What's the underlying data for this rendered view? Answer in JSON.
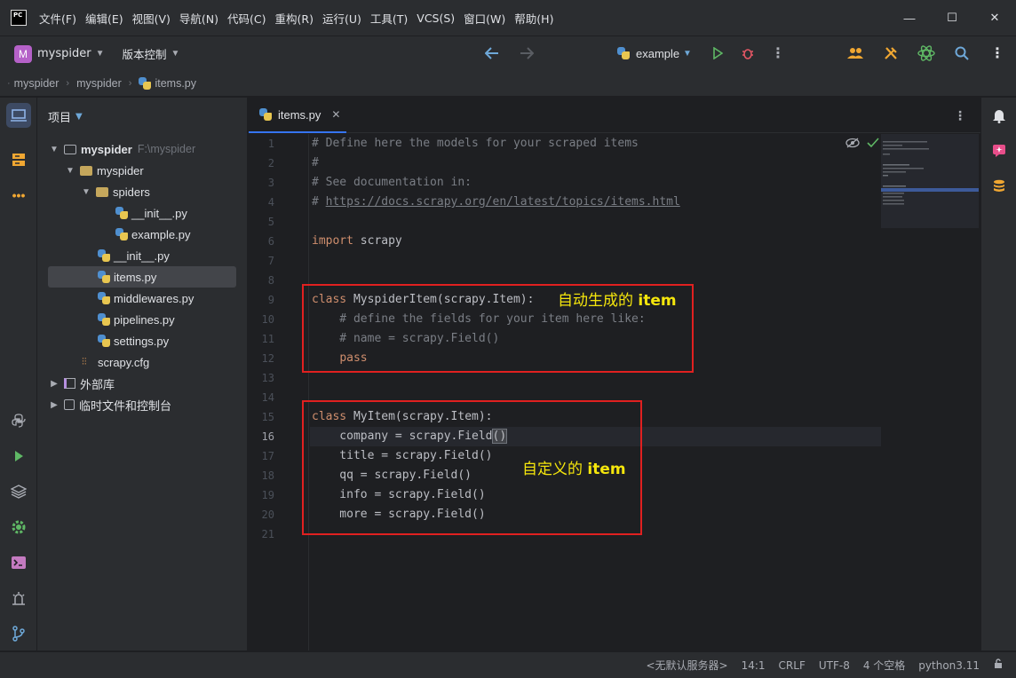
{
  "app": {
    "logo_text": "PC"
  },
  "menu": [
    "文件(F)",
    "编辑(E)",
    "视图(V)",
    "导航(N)",
    "代码(C)",
    "重构(R)",
    "运行(U)",
    "工具(T)",
    "VCS(S)",
    "窗口(W)",
    "帮助(H)"
  ],
  "window_controls": {
    "minimize": "—",
    "maximize": "☐",
    "close": "✕"
  },
  "toolbar": {
    "project_avatar": "M",
    "project_name": "myspider",
    "vcs_label": "版本控制",
    "run_config": "example"
  },
  "breadcrumb": [
    "myspider",
    "myspider",
    "items.py"
  ],
  "project_panel": {
    "title": "项目",
    "tree": [
      {
        "label": "myspider",
        "hint": "F:\\myspider",
        "type": "project"
      },
      {
        "label": "myspider",
        "type": "folder"
      },
      {
        "label": "spiders",
        "type": "folder"
      },
      {
        "label": "__init__.py",
        "type": "py"
      },
      {
        "label": "example.py",
        "type": "py"
      },
      {
        "label": "__init__.py",
        "type": "py"
      },
      {
        "label": "items.py",
        "type": "py",
        "selected": true
      },
      {
        "label": "middlewares.py",
        "type": "py"
      },
      {
        "label": "pipelines.py",
        "type": "py"
      },
      {
        "label": "settings.py",
        "type": "py"
      },
      {
        "label": "scrapy.cfg",
        "type": "cfg"
      },
      {
        "label": "外部库",
        "type": "lib"
      },
      {
        "label": "临时文件和控制台",
        "type": "scratch"
      }
    ]
  },
  "editor": {
    "tab_label": "items.py",
    "tab_close": "✕",
    "current_line": 16,
    "lines": [
      "# Define here the models for your scraped items",
      "#",
      "# See documentation in:",
      "# https://docs.scrapy.org/en/latest/topics/items.html",
      "",
      "import scrapy",
      "",
      "",
      "class MyspiderItem(scrapy.Item):",
      "    # define the fields for your item here like:",
      "    # name = scrapy.Field()",
      "    pass",
      "",
      "",
      "class MyItem(scrapy.Item):",
      "    company = scrapy.Field()",
      "    title = scrapy.Field()",
      "    qq = scrapy.Field()",
      "    info = scrapy.Field()",
      "    more = scrapy.Field()",
      ""
    ],
    "annotations": [
      {
        "prefix": "自动生成的 ",
        "word": "item"
      },
      {
        "prefix": "自定义的 ",
        "word": "item"
      }
    ]
  },
  "status_bar": [
    "<无默认服务器>",
    "14:1",
    "CRLF",
    "UTF-8",
    "4 个空格",
    "python3.11"
  ],
  "colors": {
    "background": "#1e1f22",
    "panel": "#2b2d30",
    "keyword": "#cf8e6d",
    "comment": "#7a7e85",
    "accent": "#3574f0",
    "annotation_border": "#e02020",
    "annotation_text": "#f5e60c"
  }
}
